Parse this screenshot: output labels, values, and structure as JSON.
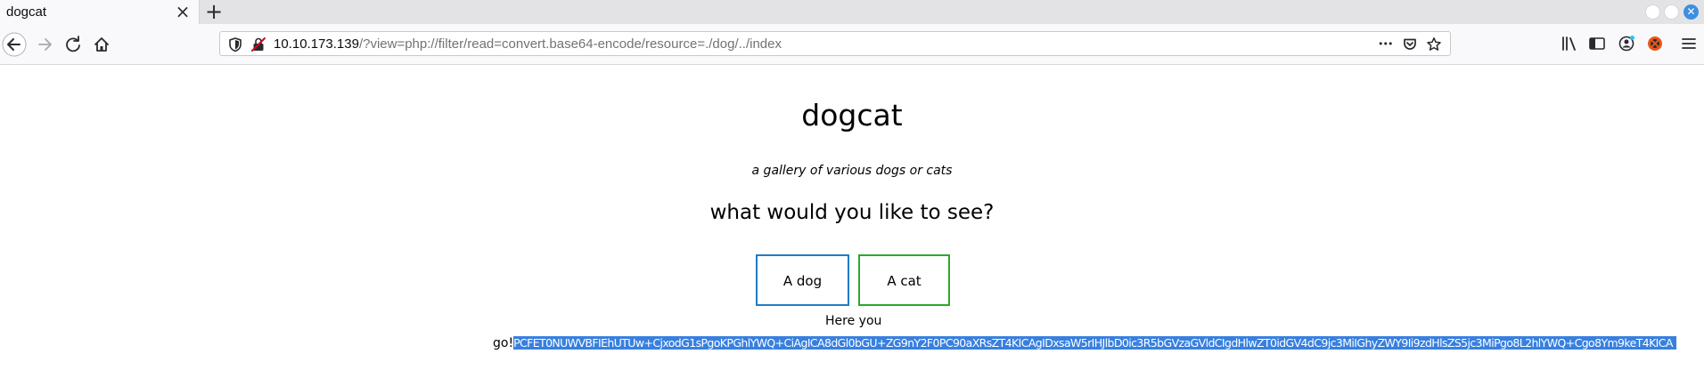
{
  "browser": {
    "tab": {
      "title": "dogcat",
      "close_glyph": "×"
    },
    "new_tab_glyph": "+",
    "url": {
      "host": "10.10.173.139",
      "path": "/?view=php://filter/read=convert.base64-encode/resource=./dog/../index"
    },
    "url_more_glyph": "•••",
    "window_close_glyph": "✕",
    "icons": [
      "back-arrow-icon",
      "forward-arrow-icon",
      "reload-icon",
      "home-icon",
      "tracking-shield-icon",
      "insecure-lock-icon",
      "page-actions-icon",
      "pocket-icon",
      "bookmark-star-icon",
      "library-icon",
      "sidebar-icon",
      "account-icon",
      "extension-icon",
      "menu-icon"
    ],
    "colors": {
      "accent": "#3d8ee0",
      "chrome": "#f9f9fb"
    }
  },
  "page": {
    "title": "dogcat",
    "tagline": "a gallery of various dogs or cats",
    "question": "what would you like to see?",
    "buttons": {
      "dog": "A dog",
      "cat": "A cat"
    },
    "output_label_1": "Here you",
    "output_label_2": "go!",
    "output_selected": "PCFET0NUWVBFIEhUTUw+CjxodG1sPgoKPGhlYWQ+CiAgICA8dGl0bGU+ZG9nY2F0PC90aXRsZT4KICAgIDxsaW5rIHJlbD0ic3R5bGVzaGVldCIgdHlwZT0idGV4dC9jc3MiIGhyZWY9Ii9zdHlsZS5jc3MiPgo8L2hlYWQ+Cgo8Ym9keT4KICA",
    "colors": {
      "dog_border": "#1f7cc4",
      "cat_border": "#2ca82c",
      "selection": "#3880df"
    }
  }
}
